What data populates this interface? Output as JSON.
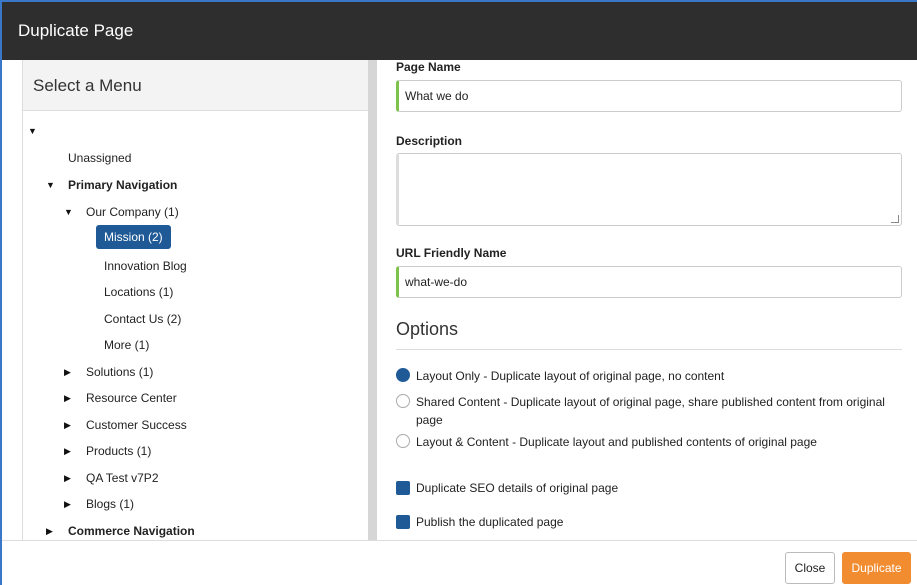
{
  "dialog": {
    "title": "Duplicate Page"
  },
  "menu": {
    "header": "Select a Menu",
    "items": [
      {
        "label": "Unassigned"
      },
      {
        "label": "Primary Navigation"
      },
      {
        "label": "Our Company (1)"
      },
      {
        "label": "Mission (2)"
      },
      {
        "label": "Innovation Blog"
      },
      {
        "label": "Locations (1)"
      },
      {
        "label": "Contact Us (2)"
      },
      {
        "label": "More (1)"
      },
      {
        "label": "Solutions (1)"
      },
      {
        "label": "Resource Center"
      },
      {
        "label": "Customer Success"
      },
      {
        "label": "Products (1)"
      },
      {
        "label": "QA Test v7P2"
      },
      {
        "label": "Blogs (1)"
      },
      {
        "label": "Commerce Navigation"
      }
    ]
  },
  "form": {
    "page_name_label": "Page Name",
    "page_name_value": "What we do",
    "description_label": "Description",
    "description_value": "",
    "url_label": "URL Friendly Name",
    "url_value": "what-we-do",
    "options_heading": "Options",
    "radios": [
      {
        "label": "Layout Only - Duplicate layout of original page, no content",
        "checked": true
      },
      {
        "label": "Shared Content - Duplicate layout of original page, share published content from original page",
        "checked": false
      },
      {
        "label": "Layout & Content - Duplicate layout and published contents of original page",
        "checked": false
      }
    ],
    "checkboxes": [
      {
        "label": "Duplicate SEO details of original page",
        "checked": true
      },
      {
        "label": "Publish the duplicated page",
        "checked": true
      }
    ]
  },
  "footer": {
    "close_label": "Close",
    "duplicate_label": "Duplicate"
  },
  "colors": {
    "accent": "#1f5a96",
    "primary_button": "#f28c30",
    "valid_border": "#7cc24b",
    "titlebar": "#2e2e2e"
  }
}
